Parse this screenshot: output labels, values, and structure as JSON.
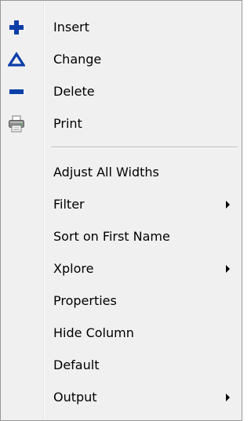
{
  "menu": {
    "items": [
      {
        "label": "Insert",
        "icon": "plus-icon",
        "color": "#0b3fa8"
      },
      {
        "label": "Change",
        "icon": "triangle-icon",
        "color": "#0b3fa8"
      },
      {
        "label": "Delete",
        "icon": "minus-icon",
        "color": "#0b3fa8"
      },
      {
        "label": "Print",
        "icon": "printer-icon"
      },
      {
        "label": "Adjust All Widths"
      },
      {
        "label": "Filter",
        "submenu": true
      },
      {
        "label": "Sort on First Name"
      },
      {
        "label": "Xplore",
        "submenu": true
      },
      {
        "label": "Properties"
      },
      {
        "label": "Hide Column"
      },
      {
        "label": "Default"
      },
      {
        "label": "Output",
        "submenu": true
      }
    ]
  }
}
